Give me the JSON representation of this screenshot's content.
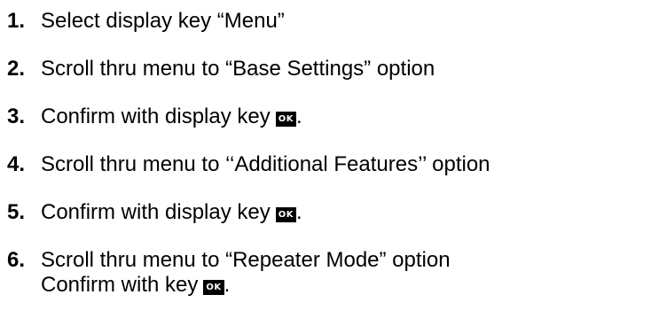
{
  "steps": [
    {
      "number": "1.",
      "text": "Select display key  “Menu”"
    },
    {
      "number": "2.",
      "text": "Scroll thru menu to “Base Settings” option"
    },
    {
      "number": "3.",
      "text": "Confirm with display key",
      "key": "OK",
      "end": "."
    },
    {
      "number": "4.",
      "text": "Scroll thru menu to  ‘‘Additional Features’’ option"
    },
    {
      "number": "5.",
      "text": "Confirm with display key",
      "key": "OK",
      "end": "."
    },
    {
      "number": "6.",
      "text": "Scroll thru menu to “Repeater Mode” option",
      "text2": "Confirm with key",
      "key": "OK",
      "end": "."
    }
  ]
}
